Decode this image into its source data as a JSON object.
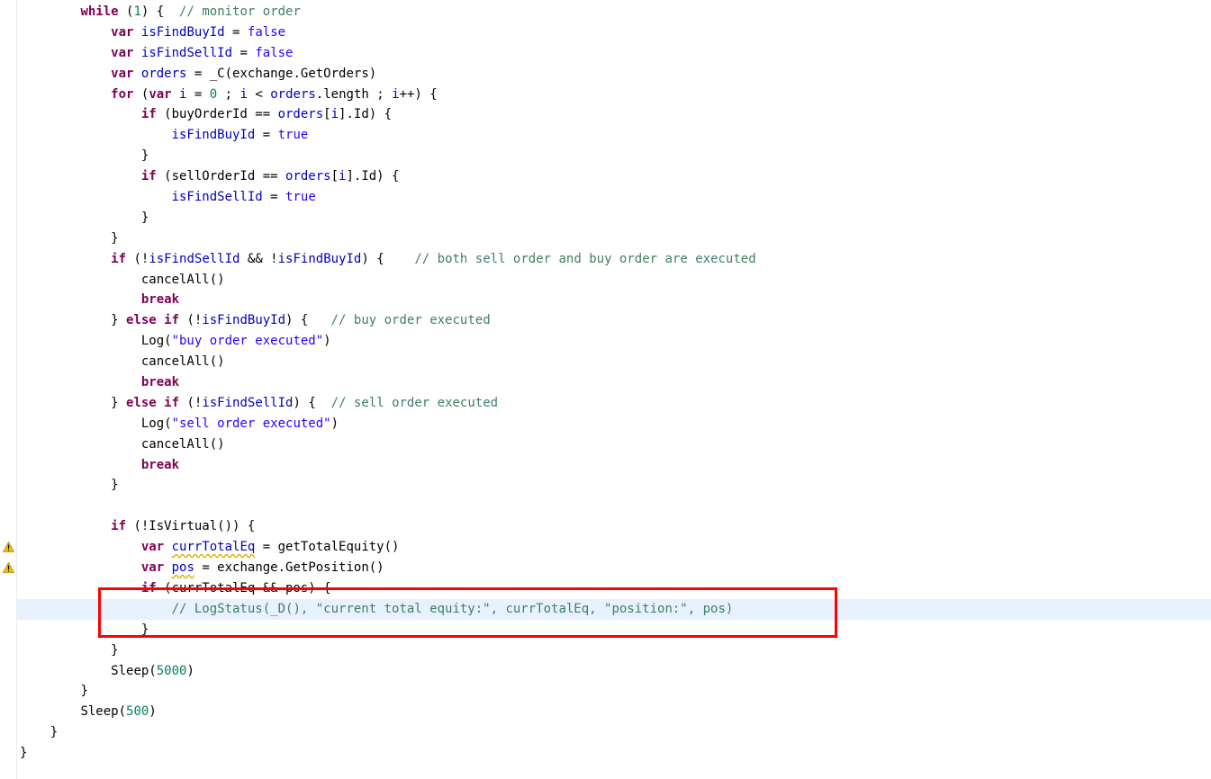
{
  "editor": {
    "lines": [
      {
        "indent": 2,
        "segments": [
          {
            "t": "while",
            "c": "kw"
          },
          {
            "t": " (",
            "c": ""
          },
          {
            "t": "1",
            "c": "num"
          },
          {
            "t": ") {  ",
            "c": ""
          },
          {
            "t": "// monitor order",
            "c": "cmt"
          }
        ]
      },
      {
        "indent": 3,
        "segments": [
          {
            "t": "var",
            "c": "kw"
          },
          {
            "t": " ",
            "c": ""
          },
          {
            "t": "isFindBuyId",
            "c": "var"
          },
          {
            "t": " = ",
            "c": ""
          },
          {
            "t": "false",
            "c": "str"
          }
        ]
      },
      {
        "indent": 3,
        "segments": [
          {
            "t": "var",
            "c": "kw"
          },
          {
            "t": " ",
            "c": ""
          },
          {
            "t": "isFindSellId",
            "c": "var"
          },
          {
            "t": " = ",
            "c": ""
          },
          {
            "t": "false",
            "c": "str"
          }
        ]
      },
      {
        "indent": 3,
        "segments": [
          {
            "t": "var",
            "c": "kw"
          },
          {
            "t": " ",
            "c": ""
          },
          {
            "t": "orders",
            "c": "var"
          },
          {
            "t": " = _C(exchange.GetOrders)",
            "c": ""
          }
        ]
      },
      {
        "indent": 3,
        "segments": [
          {
            "t": "for",
            "c": "kw"
          },
          {
            "t": " (",
            "c": ""
          },
          {
            "t": "var",
            "c": "kw"
          },
          {
            "t": " ",
            "c": ""
          },
          {
            "t": "i",
            "c": "var"
          },
          {
            "t": " = ",
            "c": ""
          },
          {
            "t": "0",
            "c": "num"
          },
          {
            "t": " ; ",
            "c": ""
          },
          {
            "t": "i",
            "c": "var"
          },
          {
            "t": " < ",
            "c": ""
          },
          {
            "t": "orders",
            "c": "var"
          },
          {
            "t": ".length ; ",
            "c": ""
          },
          {
            "t": "i",
            "c": "var"
          },
          {
            "t": "++) {",
            "c": ""
          }
        ]
      },
      {
        "indent": 4,
        "segments": [
          {
            "t": "if",
            "c": "kw"
          },
          {
            "t": " (buyOrderId == ",
            "c": ""
          },
          {
            "t": "orders",
            "c": "var"
          },
          {
            "t": "[",
            "c": ""
          },
          {
            "t": "i",
            "c": "var"
          },
          {
            "t": "].Id) {",
            "c": ""
          }
        ]
      },
      {
        "indent": 5,
        "segments": [
          {
            "t": "isFindBuyId",
            "c": "var"
          },
          {
            "t": " = ",
            "c": ""
          },
          {
            "t": "true",
            "c": "str"
          }
        ]
      },
      {
        "indent": 4,
        "segments": [
          {
            "t": "}",
            "c": ""
          }
        ]
      },
      {
        "indent": 4,
        "segments": [
          {
            "t": "if",
            "c": "kw"
          },
          {
            "t": " (sellOrderId == ",
            "c": ""
          },
          {
            "t": "orders",
            "c": "var"
          },
          {
            "t": "[",
            "c": ""
          },
          {
            "t": "i",
            "c": "var"
          },
          {
            "t": "].Id) {",
            "c": ""
          }
        ]
      },
      {
        "indent": 5,
        "segments": [
          {
            "t": "isFindSellId",
            "c": "var"
          },
          {
            "t": " = ",
            "c": ""
          },
          {
            "t": "true",
            "c": "str"
          }
        ]
      },
      {
        "indent": 4,
        "segments": [
          {
            "t": "}",
            "c": ""
          }
        ]
      },
      {
        "indent": 3,
        "segments": [
          {
            "t": "}",
            "c": ""
          }
        ]
      },
      {
        "indent": 3,
        "segments": [
          {
            "t": "if",
            "c": "kw"
          },
          {
            "t": " (!",
            "c": ""
          },
          {
            "t": "isFindSellId",
            "c": "var"
          },
          {
            "t": " && !",
            "c": ""
          },
          {
            "t": "isFindBuyId",
            "c": "var"
          },
          {
            "t": ") {    ",
            "c": ""
          },
          {
            "t": "// both sell order and buy order are executed",
            "c": "cmt"
          }
        ]
      },
      {
        "indent": 4,
        "segments": [
          {
            "t": "cancelAll()",
            "c": ""
          }
        ]
      },
      {
        "indent": 4,
        "segments": [
          {
            "t": "break",
            "c": "kw"
          }
        ]
      },
      {
        "indent": 3,
        "segments": [
          {
            "t": "} ",
            "c": ""
          },
          {
            "t": "else",
            "c": "kw"
          },
          {
            "t": " ",
            "c": ""
          },
          {
            "t": "if",
            "c": "kw"
          },
          {
            "t": " (!",
            "c": ""
          },
          {
            "t": "isFindBuyId",
            "c": "var"
          },
          {
            "t": ") {   ",
            "c": ""
          },
          {
            "t": "// buy order executed",
            "c": "cmt"
          }
        ]
      },
      {
        "indent": 4,
        "segments": [
          {
            "t": "Log(",
            "c": ""
          },
          {
            "t": "\"buy order executed\"",
            "c": "str"
          },
          {
            "t": ")",
            "c": ""
          }
        ]
      },
      {
        "indent": 4,
        "segments": [
          {
            "t": "cancelAll()",
            "c": ""
          }
        ]
      },
      {
        "indent": 4,
        "segments": [
          {
            "t": "break",
            "c": "kw"
          }
        ]
      },
      {
        "indent": 3,
        "segments": [
          {
            "t": "} ",
            "c": ""
          },
          {
            "t": "else",
            "c": "kw"
          },
          {
            "t": " ",
            "c": ""
          },
          {
            "t": "if",
            "c": "kw"
          },
          {
            "t": " (!",
            "c": ""
          },
          {
            "t": "isFindSellId",
            "c": "var"
          },
          {
            "t": ") {  ",
            "c": ""
          },
          {
            "t": "// sell order executed",
            "c": "cmt"
          }
        ]
      },
      {
        "indent": 4,
        "segments": [
          {
            "t": "Log(",
            "c": ""
          },
          {
            "t": "\"sell order executed\"",
            "c": "str"
          },
          {
            "t": ")",
            "c": ""
          }
        ]
      },
      {
        "indent": 4,
        "segments": [
          {
            "t": "cancelAll()",
            "c": ""
          }
        ]
      },
      {
        "indent": 4,
        "segments": [
          {
            "t": "break",
            "c": "kw"
          }
        ]
      },
      {
        "indent": 3,
        "segments": [
          {
            "t": "}",
            "c": ""
          }
        ]
      },
      {
        "indent": 0,
        "segments": []
      },
      {
        "indent": 3,
        "segments": [
          {
            "t": "if",
            "c": "kw"
          },
          {
            "t": " (!IsVirtual()) {",
            "c": ""
          }
        ]
      },
      {
        "indent": 4,
        "warning": true,
        "segments": [
          {
            "t": "var",
            "c": "kw"
          },
          {
            "t": " ",
            "c": ""
          },
          {
            "t": "currTotalEq",
            "c": "warn-var"
          },
          {
            "t": " = getTotalEquity()",
            "c": ""
          }
        ]
      },
      {
        "indent": 4,
        "warning": true,
        "segments": [
          {
            "t": "var",
            "c": "kw"
          },
          {
            "t": " ",
            "c": ""
          },
          {
            "t": "pos",
            "c": "warn-var"
          },
          {
            "t": " = exchange.GetPosition()",
            "c": ""
          }
        ]
      },
      {
        "indent": 4,
        "segments": [
          {
            "t": "if",
            "c": "kw"
          },
          {
            "t": " (currTotalEq && pos) {",
            "c": ""
          }
        ]
      },
      {
        "indent": 5,
        "current": true,
        "segments": [
          {
            "t": "// LogStatus(_D(), \"current total equity:\", currTotalEq, \"position:\", pos)",
            "c": "cmt"
          }
        ]
      },
      {
        "indent": 4,
        "segments": [
          {
            "t": "}",
            "c": ""
          }
        ]
      },
      {
        "indent": 3,
        "segments": [
          {
            "t": "}",
            "c": ""
          }
        ]
      },
      {
        "indent": 3,
        "segments": [
          {
            "t": "Sleep(",
            "c": ""
          },
          {
            "t": "5000",
            "c": "num"
          },
          {
            "t": ")",
            "c": ""
          }
        ]
      },
      {
        "indent": 2,
        "segments": [
          {
            "t": "}",
            "c": ""
          }
        ]
      },
      {
        "indent": 2,
        "segments": [
          {
            "t": "Sleep(",
            "c": ""
          },
          {
            "t": "500",
            "c": "num"
          },
          {
            "t": ")",
            "c": ""
          }
        ]
      },
      {
        "indent": 1,
        "segments": [
          {
            "t": "}",
            "c": ""
          }
        ]
      },
      {
        "indent": 0,
        "segments": [
          {
            "t": "}",
            "c": ""
          }
        ]
      }
    ]
  },
  "colors": {
    "keyword": "#7f0055",
    "variable": "#0000c0",
    "number": "#0a7c64",
    "string": "#2a00ff",
    "comment": "#3f7f5f",
    "current_line": "#e8f2fe",
    "annotation_box": "#ff0000"
  },
  "icons": {
    "warning": "warning-icon"
  }
}
